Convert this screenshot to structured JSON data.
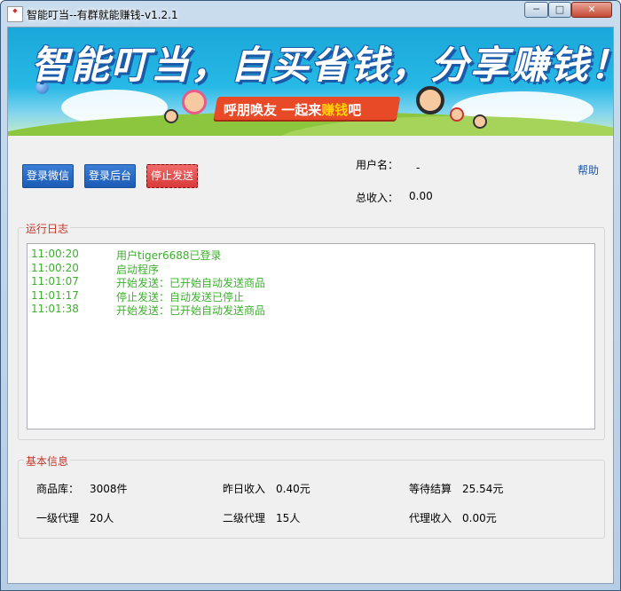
{
  "window": {
    "title": "智能叮当--有群就能赚钱-v1.2.1",
    "icon_name": "app-icon",
    "controls": {
      "minimize": "─",
      "maximize": "□",
      "close": "✕"
    }
  },
  "banner": {
    "slogan": "智能叮当，自买省钱，分享赚钱！",
    "ribbon_part1": "呼朋唤友  一起来",
    "ribbon_highlight": "赚钱",
    "ribbon_part2": "吧",
    "colors": {
      "sky": "#1aa7d9",
      "ribbon": "#e84a28",
      "highlight": "#ffd400"
    }
  },
  "toolbar": {
    "login_wechat": "登录微信",
    "login_backend": "登录后台",
    "stop_sending": "停止发送"
  },
  "user": {
    "username_label": "用户名：",
    "username_value": "-",
    "total_income_label": "总收入：",
    "total_income_value": "0.00",
    "help": "帮助"
  },
  "log": {
    "title": "运行日志",
    "entries": [
      {
        "time": "11:00:20",
        "message": "用户tiger6688已登录"
      },
      {
        "time": "11:00:20",
        "message": "启动程序"
      },
      {
        "time": "11:01:07",
        "message": "开始发送：已开始自动发送商品"
      },
      {
        "time": "11:01:17",
        "message": "停止发送：自动发送已停止"
      },
      {
        "time": "11:01:38",
        "message": "开始发送：已开始自动发送商品"
      }
    ],
    "text_color": "#3cb02c"
  },
  "info": {
    "title": "基本信息",
    "fields": [
      {
        "label": "商品库：",
        "value": "3008件"
      },
      {
        "label": "昨日收入",
        "value": "0.40元"
      },
      {
        "label": "等待结算",
        "value": "25.54元"
      },
      {
        "label": "一级代理",
        "value": "20人"
      },
      {
        "label": "二级代理",
        "value": "15人"
      },
      {
        "label": "代理收入",
        "value": "0.00元"
      }
    ]
  }
}
